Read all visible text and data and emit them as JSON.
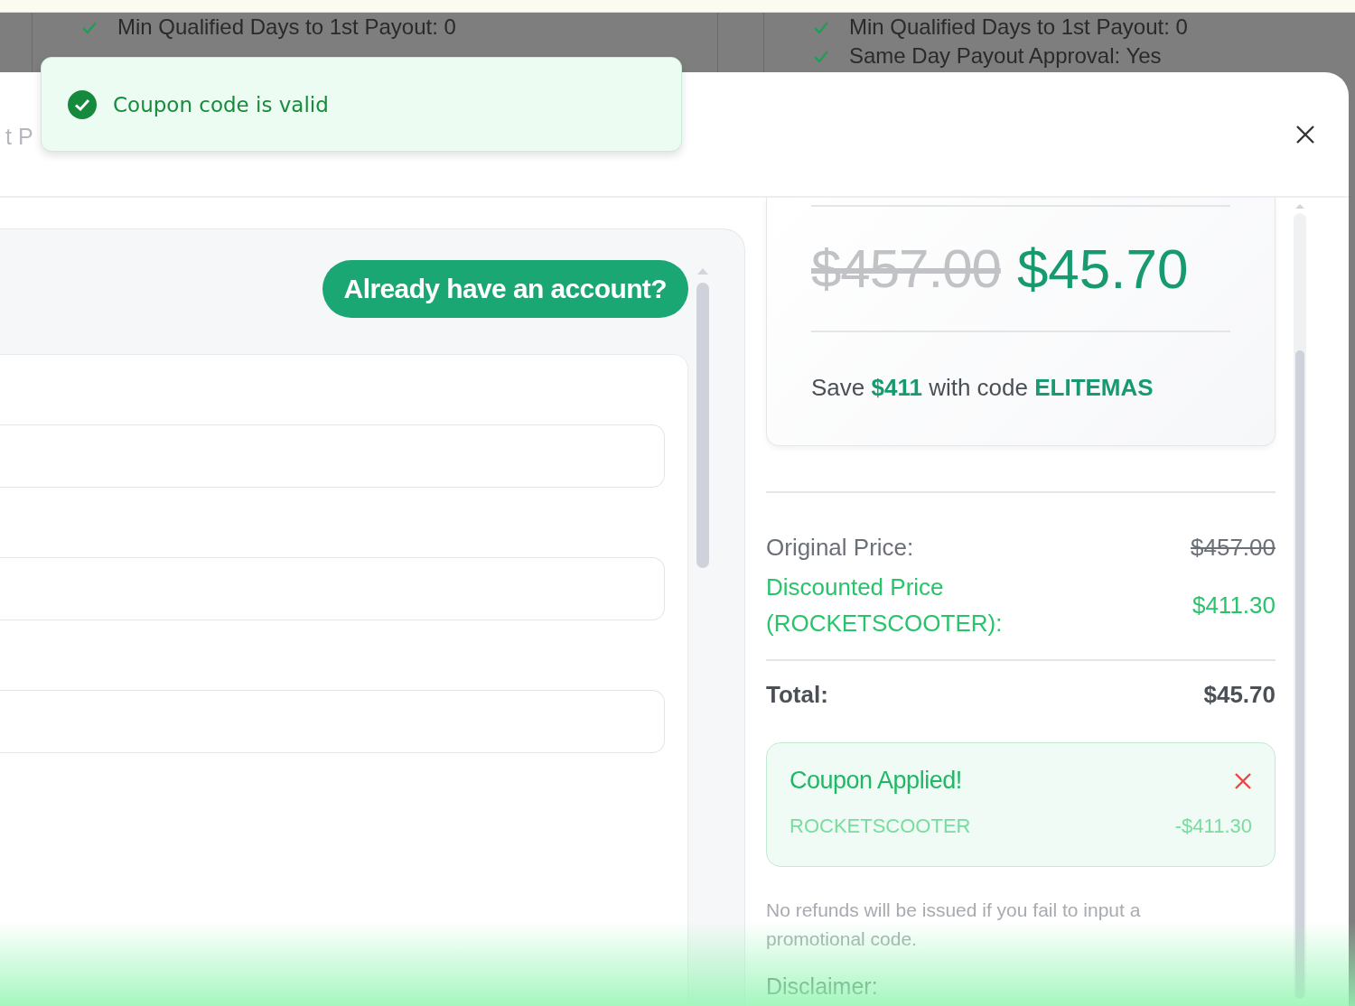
{
  "background": {
    "columns": [
      {
        "items": [
          {
            "text": "Min Qualified Days to 1st Payout: 0"
          }
        ]
      },
      {
        "items": [
          {
            "text": "Min Qualified Days to 1st Payout: 0"
          },
          {
            "text": "Same Day Payout Approval: Yes"
          }
        ]
      }
    ]
  },
  "toast": {
    "kind": "success",
    "message": "Coupon code is valid"
  },
  "modal": {
    "title": "t P",
    "account_button": "Already have an account?",
    "form": {
      "fields": [
        {
          "kind": "text"
        },
        {
          "kind": "text"
        },
        {
          "kind": "text"
        }
      ]
    },
    "price_card": {
      "original": "$457.00",
      "current": "$45.70",
      "save_note": "Save **$411** with code **ELITEMAS**"
    },
    "summary": {
      "rows": [
        {
          "kind": "original",
          "label": "Original Price:",
          "value": "$457.00"
        },
        {
          "kind": "discount",
          "label": "Discounted Price (ROCKETSCOOTER):",
          "value": "$411.30"
        },
        {
          "kind": "total",
          "label": "Total:",
          "value": "$45.70"
        }
      ]
    },
    "coupon": {
      "title": "Coupon Applied!",
      "code": "ROCKETSCOOTER",
      "amount": "-$411.30"
    },
    "refund_note": "No refunds will be issued if you fail to input a promotional code.",
    "disclaimer_heading": "Disclaimer:"
  }
}
